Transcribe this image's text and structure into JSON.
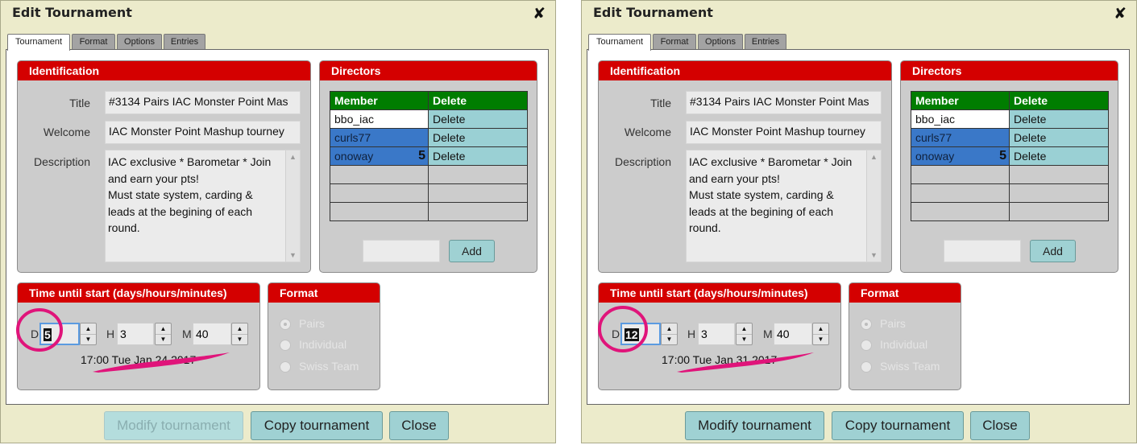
{
  "panels": [
    {
      "title": "Edit Tournament",
      "close_glyph": "✘",
      "tabs": [
        "Tournament",
        "Format",
        "Options",
        "Entries"
      ],
      "identification": {
        "header": "Identification",
        "title_label": "Title",
        "title_value": "#3134 Pairs IAC Monster Point Mas",
        "welcome_label": "Welcome",
        "welcome_value": "IAC Monster Point Mashup tourney",
        "description_label": "Description",
        "description_lines": [
          "IAC exclusive * Barometar * Join",
          "and earn your pts!",
          "Must state system, carding &",
          "leads at the begining of each",
          "round."
        ]
      },
      "directors": {
        "header": "Directors",
        "col_member": "Member",
        "col_delete": "Delete",
        "rows": [
          {
            "member": "bbo_iac",
            "delete": "Delete"
          },
          {
            "member": "curls77",
            "delete": "Delete"
          },
          {
            "member": "onoway",
            "delete": "Delete",
            "badge": "5"
          }
        ],
        "add_label": "Add"
      },
      "time": {
        "header": "Time until start (days/hours/minutes)",
        "d_label": "D",
        "d_value": "5",
        "h_label": "H",
        "h_value": "3",
        "m_label": "M",
        "m_value": "40",
        "start_text": "17:00 Tue Jan 24 2017"
      },
      "format": {
        "header": "Format",
        "options": [
          "Pairs",
          "Individual",
          "Swiss Team"
        ]
      },
      "buttons": {
        "modify": "Modify tournament",
        "copy": "Copy tournament",
        "close": "Close"
      }
    },
    {
      "title": "Edit Tournament",
      "close_glyph": "✘",
      "tabs": [
        "Tournament",
        "Format",
        "Options",
        "Entries"
      ],
      "identification": {
        "header": "Identification",
        "title_label": "Title",
        "title_value": "#3134 Pairs IAC Monster Point Mas",
        "welcome_label": "Welcome",
        "welcome_value": "IAC Monster Point Mashup tourney",
        "description_label": "Description",
        "description_lines": [
          "IAC exclusive * Barometar * Join",
          "and earn your pts!",
          "Must state system, carding &",
          "leads at the begining of each",
          "round."
        ]
      },
      "directors": {
        "header": "Directors",
        "col_member": "Member",
        "col_delete": "Delete",
        "rows": [
          {
            "member": "bbo_iac",
            "delete": "Delete"
          },
          {
            "member": "curls77",
            "delete": "Delete"
          },
          {
            "member": "onoway",
            "delete": "Delete",
            "badge": "5"
          }
        ],
        "add_label": "Add"
      },
      "time": {
        "header": "Time until start (days/hours/minutes)",
        "d_label": "D",
        "d_value": "12",
        "h_label": "H",
        "h_value": "3",
        "m_label": "M",
        "m_value": "40",
        "start_text": "17:00 Tue Jan 31 2017"
      },
      "format": {
        "header": "Format",
        "options": [
          "Pairs",
          "Individual",
          "Swiss Team"
        ]
      },
      "buttons": {
        "modify": "Modify tournament",
        "copy": "Copy tournament",
        "close": "Close"
      }
    }
  ],
  "colors": {
    "dialog_bg": "#ecebcb",
    "group_header_red": "#d40000",
    "table_header_green": "#007d00",
    "member_blue": "#3a78c8",
    "button_teal": "#9fd1d3",
    "annotation_magenta": "#e0147a"
  }
}
